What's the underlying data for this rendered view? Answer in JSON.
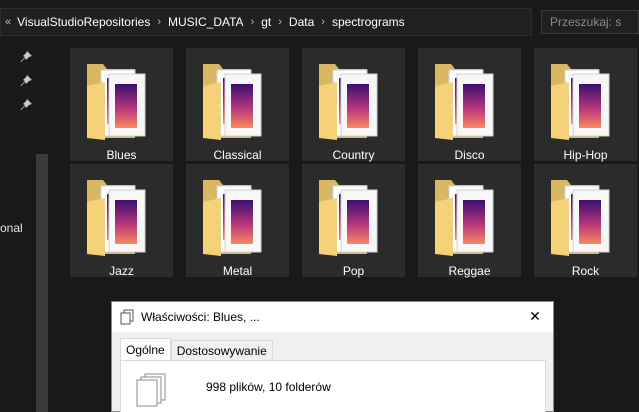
{
  "breadcrumb": {
    "lead": "«",
    "segments": [
      "VisualStudioRepositories",
      "MUSIC_DATA",
      "gt",
      "Data",
      "spectrograms"
    ],
    "separator": "›"
  },
  "search": {
    "placeholder": "Przeszukaj: s"
  },
  "nav": {
    "partial_label": "onal"
  },
  "folders": [
    {
      "label": "Blues"
    },
    {
      "label": "Classical"
    },
    {
      "label": "Country"
    },
    {
      "label": "Disco"
    },
    {
      "label": "Hip-Hop"
    },
    {
      "label": "Jazz"
    },
    {
      "label": "Metal"
    },
    {
      "label": "Pop"
    },
    {
      "label": "Reggae"
    },
    {
      "label": "Rock"
    }
  ],
  "dialog": {
    "title": "Właściwości: Blues, ...",
    "close": "✕",
    "tabs": [
      {
        "label": "Ogólne",
        "active": true
      },
      {
        "label": "Dostosowywanie",
        "active": false
      }
    ],
    "summary": "998 plików, 10 folderów"
  },
  "colors": {
    "background": "#191919",
    "tile": "#2b2b2b",
    "folder": "#f5d27a",
    "spectrogram_dark": "#3b0f70",
    "spectrogram_mid": "#b5367a",
    "spectrogram_hot": "#fb8761"
  }
}
